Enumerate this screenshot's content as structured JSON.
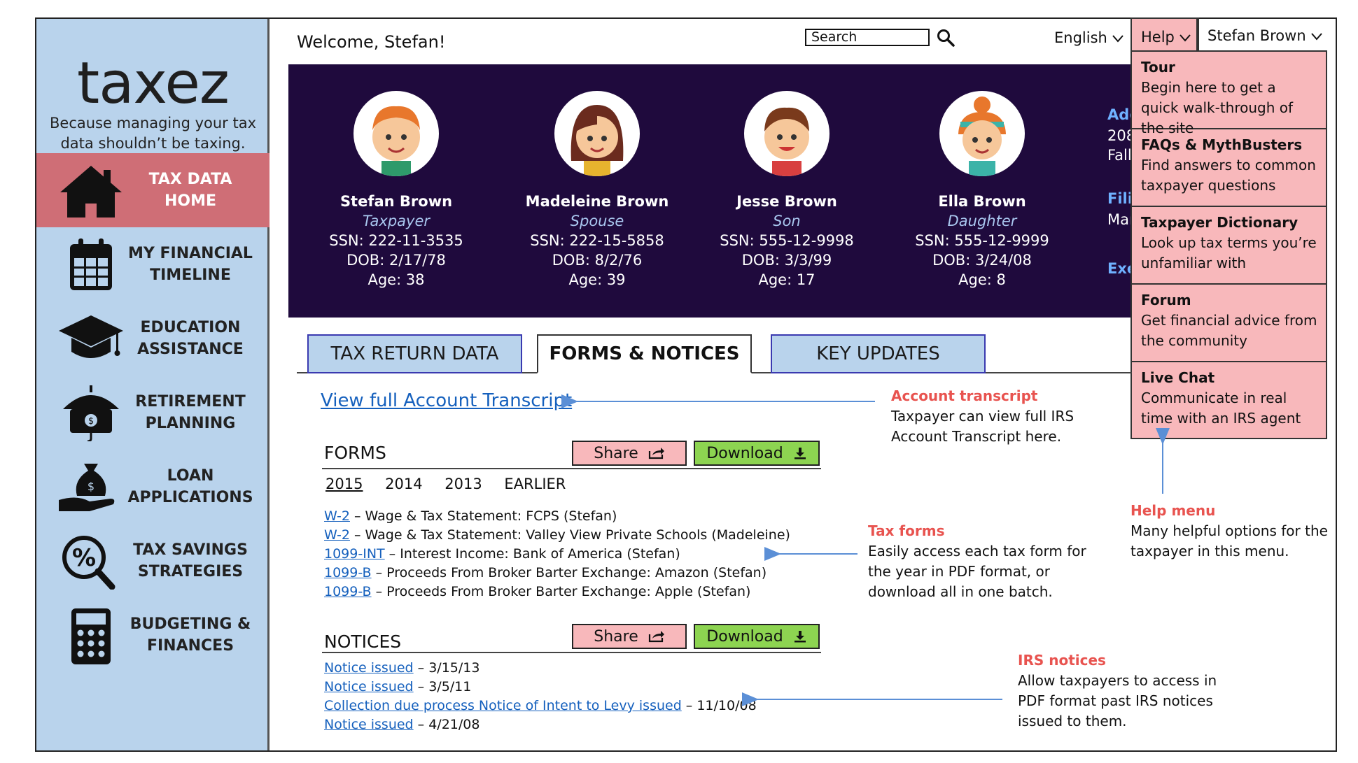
{
  "app": {
    "logo": "taxez",
    "tagline": "Because managing your tax data shouldn’t be taxing."
  },
  "sidebar": {
    "items": [
      {
        "label": "TAX DATA HOME",
        "icon": "house-icon",
        "active": true
      },
      {
        "label": "MY FINANCIAL TIMELINE",
        "icon": "calendar-icon",
        "active": false
      },
      {
        "label": "EDUCATION ASSISTANCE",
        "icon": "graduation-cap-icon",
        "active": false
      },
      {
        "label": "RETIREMENT PLANNING",
        "icon": "umbrella-money-icon",
        "active": false
      },
      {
        "label": "LOAN APPLICATIONS",
        "icon": "money-bag-hand-icon",
        "active": false
      },
      {
        "label": "TAX SAVINGS STRATEGIES",
        "icon": "percent-magnifier-icon",
        "active": false
      },
      {
        "label": "BUDGETING & FINANCES",
        "icon": "calculator-icon",
        "active": false
      }
    ]
  },
  "header": {
    "welcome": "Welcome, Stefan!",
    "search_placeholder": "Search",
    "language": "English",
    "help_label": "Help",
    "user_label": "Stefan Brown"
  },
  "family": [
    {
      "name": "Stefan Brown",
      "role": "Taxpayer",
      "ssn": "SSN: 222-11-3535",
      "dob": "DOB: 2/17/78",
      "age": "Age: 38"
    },
    {
      "name": "Madeleine Brown",
      "role": "Spouse",
      "ssn": "SSN: 222-15-5858",
      "dob": "DOB: 8/2/76",
      "age": "Age: 39"
    },
    {
      "name": "Jesse Brown",
      "role": "Son",
      "ssn": "SSN: 555-12-9998",
      "dob": "DOB: 3/3/99",
      "age": "Age: 17"
    },
    {
      "name": "Ella Brown",
      "role": "Daughter",
      "ssn": "SSN: 555-12-9999",
      "dob": "DOB: 3/24/08",
      "age": "Age: 8"
    }
  ],
  "banner_side": {
    "address_label": "Add",
    "address_line1": "208",
    "address_line2": "Fall",
    "filing_label": "Filin",
    "filing_value": "Mar",
    "exemptions_label": "Exe"
  },
  "help_menu": [
    {
      "title": "Tour",
      "desc": "Begin here to get a quick walk-through of the site"
    },
    {
      "title": "FAQs & MythBusters",
      "desc": "Find answers to common taxpayer questions"
    },
    {
      "title": "Taxpayer Dictionary",
      "desc": "Look up tax terms you’re unfamiliar with"
    },
    {
      "title": "Forum",
      "desc": "Get financial advice from the community"
    },
    {
      "title": "Live Chat",
      "desc": "Communicate in real time with an IRS agent"
    }
  ],
  "tabs": [
    {
      "label": "TAX RETURN DATA",
      "active": false
    },
    {
      "label": "FORMS & NOTICES",
      "active": true
    },
    {
      "label": "KEY UPDATES",
      "active": false
    }
  ],
  "content": {
    "transcript_link": "View full Account Transcript",
    "forms_title": "FORMS",
    "notices_title": "NOTICES",
    "share_label": "Share",
    "download_label": "Download",
    "years": [
      "2015",
      "2014",
      "2013",
      "EARLIER"
    ],
    "forms": [
      {
        "link": "W-2",
        "text": " – Wage & Tax Statement: FCPS (Stefan)"
      },
      {
        "link": "W-2",
        "text": " – Wage & Tax Statement: Valley View Private Schools (Madeleine)"
      },
      {
        "link": "1099-INT",
        "text": " – Interest Income: Bank of America (Stefan)"
      },
      {
        "link": "1099-B",
        "text": " – Proceeds From Broker Barter Exchange: Amazon (Stefan)"
      },
      {
        "link": "1099-B",
        "text": " – Proceeds From Broker Barter Exchange: Apple (Stefan)"
      }
    ],
    "notices": [
      {
        "link": "Notice issued",
        "text": " – 3/15/13"
      },
      {
        "link": "Notice issued",
        "text": " – 3/5/11"
      },
      {
        "link": "Collection due process Notice of Intent to Levy issued",
        "text": " – 11/10/08"
      },
      {
        "link": "Notice issued",
        "text": " – 4/21/08"
      }
    ]
  },
  "annotations": {
    "transcript": {
      "title": "Account transcript",
      "desc": "Taxpayer can view full IRS Account Transcript here."
    },
    "forms": {
      "title": "Tax forms",
      "desc": "Easily access each tax form for the year in PDF format, or download all in one batch."
    },
    "help": {
      "title": "Help menu",
      "desc": "Many helpful options for the taxpayer in this menu."
    },
    "notices": {
      "title": "IRS notices",
      "desc": "Allow taxpayers to access in PDF format past IRS notices issued to them."
    }
  },
  "colors": {
    "sidebar_bg": "#b9d3ec",
    "active_nav": "#cf6e76",
    "banner_bg": "#1f0a3d",
    "help_bg": "#f8b8bb",
    "download_bg": "#8dd451",
    "annotation_title": "#e8534f",
    "link": "#1560bd"
  }
}
